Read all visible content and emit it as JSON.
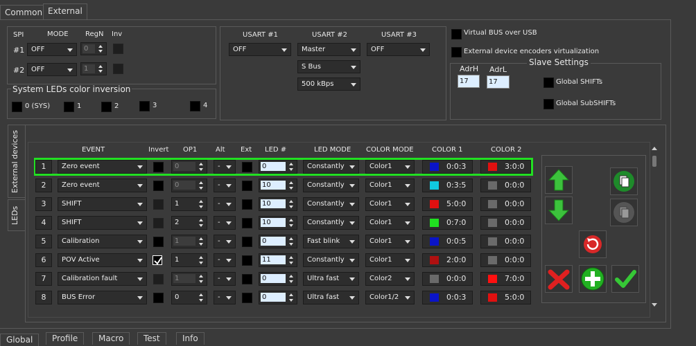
{
  "tabs": {
    "common": "Common",
    "external": "External"
  },
  "spi": {
    "spi_label": "SPI",
    "mode_label": "MODE",
    "regn_label": "RegN",
    "inv_label": "Inv",
    "rows": [
      {
        "num": "#1",
        "mode": "OFF",
        "regn": "0"
      },
      {
        "num": "#2",
        "mode": "OFF",
        "regn": "1"
      }
    ]
  },
  "sysleds": {
    "title": "System LEDs color inversion",
    "items": [
      "0 (SYS)",
      "1",
      "2",
      "3",
      "4"
    ]
  },
  "usart": {
    "h1": "USART #1",
    "h2": "USART #2",
    "h3": "USART #3",
    "u1": "OFF",
    "u2": "Master",
    "u3": "OFF",
    "u2_proto": "S Bus",
    "u2_baud": "500 kBps"
  },
  "options": {
    "vbus": "Virtual BUS over USB",
    "encvirt": "External device encoders virtualization"
  },
  "slave": {
    "title": "Slave Settings",
    "adrh_label": "AdrH",
    "adrl_label": "AdrL",
    "adrh": "17",
    "adrl": "17",
    "gshifts": "Global SHIFTs",
    "gsubshifts": "Global SubSHIFTs"
  },
  "sidetabs": {
    "external": "External devices",
    "leds": "LEDs"
  },
  "table": {
    "headers": {
      "event": "EVENT",
      "invert": "Invert",
      "op1": "OP1",
      "alt": "Alt",
      "ext": "Ext",
      "led": "LED #",
      "ledmode": "LED MODE",
      "colormode": "COLOR MODE",
      "color1": "COLOR 1",
      "color2": "COLOR 2"
    },
    "rows": [
      {
        "n": "1",
        "event": "Zero event",
        "invert": "on",
        "op1": "0",
        "alt": "-",
        "led": "0",
        "ledmode": "Constantly",
        "colormode": "Color1",
        "c1": "0:0:3",
        "c1col": "#0a14c8",
        "c2": "3:0:0",
        "c2col": "#e01010"
      },
      {
        "n": "2",
        "event": "Zero event",
        "invert": "on",
        "op1": "0",
        "alt": "-",
        "led": "10",
        "ledmode": "Constantly",
        "colormode": "Color1",
        "c1": "0:3:5",
        "c1col": "#10c8e0",
        "c2": "0:0:0",
        "c2col": "#6a6a6a"
      },
      {
        "n": "3",
        "event": "SHIFT",
        "invert": "dis",
        "op1": "1",
        "alt": "-",
        "led": "10",
        "ledmode": "Constantly",
        "colormode": "Color1",
        "c1": "5:0:0",
        "c1col": "#e01010",
        "c2": "0:0:0",
        "c2col": "#6a6a6a"
      },
      {
        "n": "4",
        "event": "SHIFT",
        "invert": "dis",
        "op1": "2",
        "alt": "-",
        "led": "10",
        "ledmode": "Constantly",
        "colormode": "Color1",
        "c1": "0:7:0",
        "c1col": "#20e020",
        "c2": "0:0:0",
        "c2col": "#6a6a6a"
      },
      {
        "n": "5",
        "event": "Calibration",
        "invert": "on",
        "op1": "1",
        "alt": "-",
        "led": "0",
        "ledmode": "Fast blink",
        "colormode": "Color1",
        "c1": "0:0:5",
        "c1col": "#0a14c8",
        "c2": "0:0:0",
        "c2col": "#6a6a6a"
      },
      {
        "n": "6",
        "event": "POV Active",
        "invert": "check",
        "op1": "1",
        "alt": "-",
        "led": "11",
        "ledmode": "Constantly",
        "colormode": "Color1",
        "c1": "2:0:0",
        "c1col": "#b01010",
        "c2": "0:0:0",
        "c2col": "#6a6a6a"
      },
      {
        "n": "7",
        "event": "Calibration fault",
        "invert": "dis",
        "op1": "1",
        "alt": "-",
        "led": "0",
        "ledmode": "Ultra fast",
        "colormode": "Color2",
        "c1": "0:0:0",
        "c1col": "#6a6a6a",
        "c2": "7:0:0",
        "c2col": "#ff1010"
      },
      {
        "n": "8",
        "event": "BUS Error",
        "invert": "on",
        "op1": "0",
        "alt": "-",
        "led": "0",
        "ledmode": "Ultra fast",
        "colormode": "Color1/2",
        "c1": "0:0:3",
        "c1col": "#0a14c8",
        "c2": "5:0:0",
        "c2col": "#e01010"
      }
    ]
  },
  "bottomtabs": {
    "global": "Global",
    "profile": "Profile",
    "macro": "Macro",
    "test": "Test",
    "info": "Info"
  },
  "colors": {
    "accent": "#22e022",
    "bg": "#3a3a3a",
    "input": "#2d2d2d"
  },
  "icons": [
    "arrow-up-icon",
    "arrow-down-icon",
    "paste-icon",
    "paste-disabled-icon",
    "reset-icon",
    "delete-icon",
    "add-icon",
    "apply-icon"
  ]
}
